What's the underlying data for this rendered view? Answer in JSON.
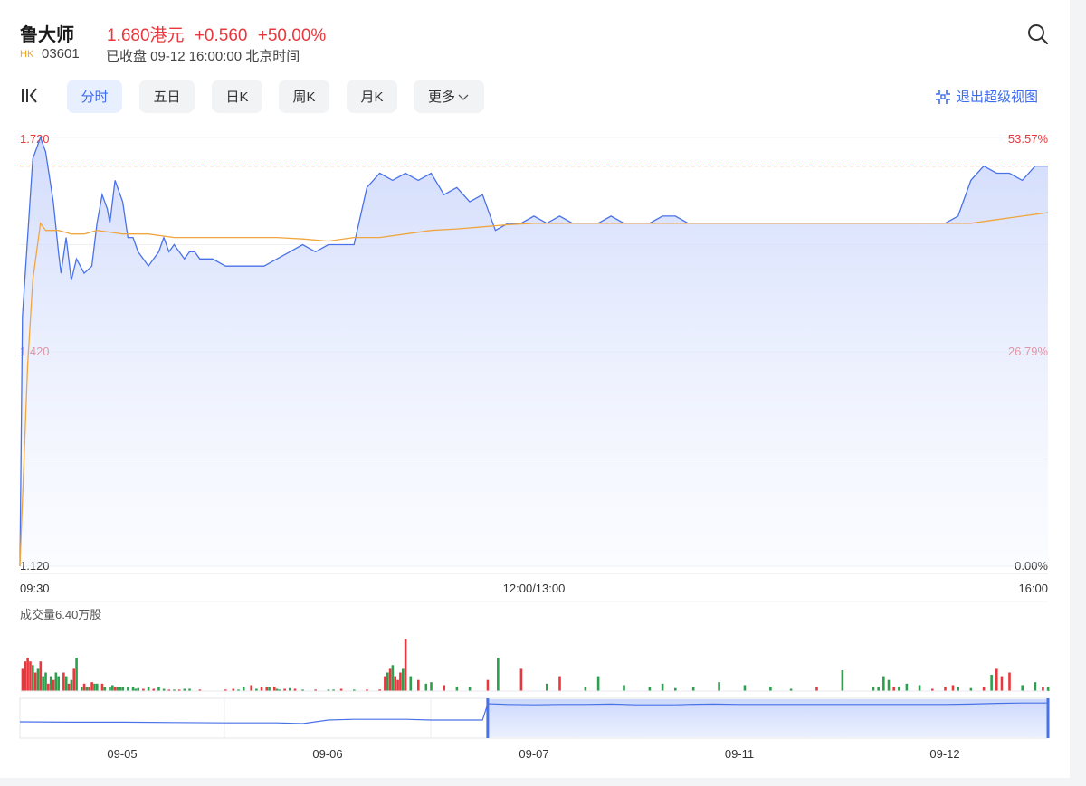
{
  "header": {
    "name": "鲁大师",
    "price": "1.680港元",
    "change": "+0.560",
    "change_pct": "+50.00%",
    "market_tag": "HK",
    "code": "03601",
    "status": "已收盘 09-12 16:00:00 北京时间"
  },
  "tabs": [
    {
      "label": "分时",
      "active": true
    },
    {
      "label": "五日",
      "active": false
    },
    {
      "label": "日K",
      "active": false
    },
    {
      "label": "周K",
      "active": false
    },
    {
      "label": "月K",
      "active": false
    },
    {
      "label": "更多",
      "active": false
    }
  ],
  "exit_label": "退出超级视图",
  "colors": {
    "up": "#e8383d",
    "down": "#2e9e4f",
    "price_line": "#4a72e8",
    "avg_line": "#f0a640",
    "accent": "#3d6cf0"
  },
  "icons": [
    "search-icon",
    "collapse-icon",
    "chevron-down-icon",
    "exit-fullscreen-icon"
  ],
  "chart_data": [
    {
      "type": "line",
      "x_labels": [
        "09:30",
        "12:00/13:00",
        "16:00"
      ],
      "y_labels_left": [
        "1.720",
        "1.420",
        "1.120"
      ],
      "y_labels_right": [
        "53.57%",
        "26.79%",
        "0.00%"
      ],
      "ylim": [
        1.12,
        1.72
      ],
      "prev_close_ref": 1.68,
      "grid": true,
      "series": [
        {
          "key": "price",
          "x": [
            0,
            1,
            3,
            5,
            8,
            10,
            13,
            15,
            16,
            18,
            20,
            22,
            25,
            28,
            30,
            32,
            34,
            35,
            37,
            40,
            42,
            44,
            46,
            48,
            50,
            52,
            54,
            56,
            58,
            60,
            62,
            64,
            66,
            68,
            70,
            75,
            80,
            85,
            90,
            95,
            100,
            105,
            110,
            115,
            120,
            125,
            130,
            135,
            140,
            145,
            150,
            155,
            160,
            165,
            170,
            175,
            180,
            185,
            190,
            195,
            200,
            205,
            210,
            215,
            220,
            225,
            230,
            235,
            240,
            245,
            250,
            255,
            260,
            265,
            270,
            275,
            280,
            285,
            290,
            295,
            300,
            305,
            310,
            315,
            320,
            325,
            330,
            335,
            340,
            345,
            350,
            355,
            360,
            365,
            370,
            375,
            380,
            385,
            390,
            395,
            400
          ],
          "values": [
            1.12,
            1.47,
            1.58,
            1.69,
            1.72,
            1.7,
            1.63,
            1.56,
            1.53,
            1.58,
            1.52,
            1.55,
            1.53,
            1.54,
            1.6,
            1.64,
            1.62,
            1.6,
            1.66,
            1.63,
            1.58,
            1.58,
            1.56,
            1.55,
            1.54,
            1.55,
            1.56,
            1.58,
            1.56,
            1.57,
            1.56,
            1.55,
            1.56,
            1.56,
            1.55,
            1.55,
            1.54,
            1.54,
            1.54,
            1.54,
            1.55,
            1.56,
            1.57,
            1.56,
            1.57,
            1.57,
            1.57,
            1.65,
            1.67,
            1.66,
            1.67,
            1.66,
            1.67,
            1.64,
            1.65,
            1.63,
            1.64,
            1.59,
            1.6,
            1.6,
            1.61,
            1.6,
            1.61,
            1.6,
            1.6,
            1.6,
            1.61,
            1.6,
            1.6,
            1.6,
            1.61,
            1.61,
            1.6,
            1.6,
            1.6,
            1.6,
            1.6,
            1.6,
            1.6,
            1.6,
            1.6,
            1.6,
            1.6,
            1.6,
            1.6,
            1.6,
            1.6,
            1.6,
            1.6,
            1.6,
            1.6,
            1.6,
            1.6,
            1.61,
            1.66,
            1.68,
            1.67,
            1.67,
            1.66,
            1.68,
            1.68
          ],
          "color": "#4a72e8"
        },
        {
          "key": "avg",
          "x": [
            0,
            3,
            5,
            8,
            10,
            15,
            20,
            25,
            30,
            40,
            50,
            60,
            70,
            80,
            90,
            100,
            110,
            120,
            130,
            140,
            150,
            160,
            170,
            180,
            190,
            200,
            210,
            220,
            230,
            240,
            250,
            260,
            270,
            280,
            290,
            300,
            310,
            320,
            330,
            340,
            350,
            360,
            370,
            380,
            390,
            400
          ],
          "values": [
            1.12,
            1.4,
            1.52,
            1.6,
            1.59,
            1.59,
            1.585,
            1.585,
            1.59,
            1.585,
            1.585,
            1.58,
            1.58,
            1.58,
            1.58,
            1.58,
            1.578,
            1.575,
            1.58,
            1.58,
            1.585,
            1.59,
            1.592,
            1.595,
            1.598,
            1.6,
            1.6,
            1.6,
            1.6,
            1.6,
            1.6,
            1.6,
            1.6,
            1.6,
            1.6,
            1.6,
            1.6,
            1.6,
            1.6,
            1.6,
            1.6,
            1.6,
            1.6,
            1.605,
            1.61,
            1.615
          ],
          "color": "#f0a640"
        }
      ]
    },
    {
      "type": "bar",
      "title": "成交量6.40万股",
      "x": [
        1,
        2,
        3,
        4,
        5,
        6,
        7,
        8,
        9,
        10,
        11,
        12,
        13,
        14,
        15,
        17,
        18,
        19,
        20,
        21,
        22,
        24,
        25,
        26,
        27,
        28,
        29,
        30,
        32,
        33,
        35,
        36,
        37,
        38,
        39,
        40,
        42,
        44,
        45,
        46,
        48,
        50,
        52,
        54,
        56,
        58,
        60,
        62,
        64,
        66,
        70,
        80,
        83,
        85,
        87,
        90,
        92,
        94,
        96,
        97,
        99,
        100,
        101,
        103,
        105,
        107,
        110,
        115,
        120,
        122,
        125,
        130,
        135,
        140,
        145,
        140,
        142,
        143,
        144,
        145,
        146,
        147,
        148,
        149,
        150,
        152,
        155,
        158,
        160,
        165,
        170,
        175,
        182,
        186,
        195,
        205,
        210,
        220,
        225,
        235,
        245,
        250,
        255,
        262,
        272,
        282,
        292,
        300,
        310,
        320,
        332,
        334,
        336,
        338,
        340,
        342,
        345,
        350,
        355,
        360,
        363,
        365,
        370,
        375,
        378,
        380,
        382,
        385,
        390,
        395,
        398,
        400
      ],
      "values": [
        0.3,
        0.4,
        0.45,
        0.4,
        0.35,
        0.25,
        0.3,
        0.4,
        0.2,
        0.25,
        0.1,
        0.2,
        0.15,
        0.25,
        0.2,
        0.25,
        0.2,
        0.1,
        0.15,
        0.3,
        0.45,
        0.05,
        0.1,
        0.05,
        0.05,
        0.12,
        0.1,
        0.1,
        0.1,
        0.05,
        0.05,
        0.08,
        0.06,
        0.05,
        0.05,
        0.05,
        0.05,
        0.05,
        0.03,
        0.04,
        0.03,
        0.05,
        0.03,
        0.05,
        0.03,
        0.02,
        0.02,
        0.02,
        0.03,
        0.03,
        0.02,
        0.02,
        0.03,
        0.02,
        0.05,
        0.08,
        0.03,
        0.05,
        0.06,
        0.05,
        0.06,
        0.03,
        0.02,
        0.03,
        0.04,
        0.03,
        0.02,
        0.02,
        0.02,
        0.02,
        0.03,
        0.02,
        0.02,
        0.02,
        0.02,
        0.02,
        0.2,
        0.25,
        0.3,
        0.35,
        0.2,
        0.15,
        0.25,
        0.3,
        0.7,
        0.2,
        0.15,
        0.1,
        0.12,
        0.08,
        0.06,
        0.05,
        0.15,
        0.45,
        0.3,
        0.1,
        0.2,
        0.05,
        0.2,
        0.08,
        0.05,
        0.1,
        0.04,
        0.05,
        0.12,
        0.08,
        0.06,
        0.03,
        0.05,
        0.28,
        0.05,
        0.06,
        0.2,
        0.15,
        0.05,
        0.06,
        0.1,
        0.08,
        0.03,
        0.06,
        0.08,
        0.05,
        0.04,
        0.05,
        0.22,
        0.3,
        0.2,
        0.25,
        0.08,
        0.12,
        0.05,
        0.06,
        0.18,
        0.25,
        0.15,
        0.1,
        0.22
      ],
      "direction": [
        "u",
        "u",
        "u",
        "u",
        "d",
        "u",
        "d",
        "u",
        "d",
        "d",
        "u",
        "d",
        "u",
        "d",
        "d",
        "u",
        "d",
        "u",
        "d",
        "u",
        "d",
        "d",
        "u",
        "d",
        "u",
        "u",
        "d",
        "d",
        "u",
        "d",
        "d",
        "d",
        "u",
        "d",
        "d",
        "d",
        "d",
        "d",
        "d",
        "d",
        "u",
        "d",
        "u",
        "d",
        "d",
        "u",
        "d",
        "u",
        "d",
        "d",
        "u",
        "u",
        "u",
        "d",
        "d",
        "u",
        "d",
        "u",
        "u",
        "d",
        "u",
        "d",
        "d",
        "u",
        "d",
        "u",
        "d",
        "u",
        "d",
        "d",
        "u",
        "d",
        "u",
        "d",
        "d",
        "u",
        "u",
        "d",
        "u",
        "d",
        "u",
        "u",
        "u",
        "d",
        "u",
        "d",
        "u",
        "d",
        "d",
        "u",
        "d",
        "d",
        "u",
        "d",
        "u",
        "d",
        "u",
        "d",
        "d",
        "d",
        "d",
        "d",
        "d",
        "d",
        "d",
        "d",
        "d",
        "d",
        "u",
        "d",
        "d",
        "d",
        "d",
        "d",
        "u",
        "d",
        "d",
        "d",
        "u",
        "u",
        "u",
        "d",
        "d",
        "u",
        "d",
        "u",
        "u",
        "u",
        "d",
        "d",
        "u",
        "d",
        "d",
        "d",
        "d",
        "d",
        "d",
        "d",
        "d",
        "d",
        "d",
        "d",
        "d"
      ]
    },
    {
      "type": "area",
      "x_labels": [
        "09-05",
        "09-06",
        "09-07",
        "09-11",
        "09-12"
      ],
      "series": [
        {
          "key": "navigator",
          "x": [
            0,
            20,
            40,
            60,
            80,
            100,
            110,
            120,
            130,
            140,
            150,
            160,
            170,
            180,
            182,
            190,
            200,
            210,
            220,
            230,
            240,
            250,
            255,
            260,
            270,
            280,
            290,
            300,
            310,
            320,
            330,
            340,
            350,
            360,
            370,
            380,
            390,
            400
          ],
          "values": [
            0.45,
            0.44,
            0.44,
            0.43,
            0.42,
            0.42,
            0.4,
            0.5,
            0.52,
            0.52,
            0.52,
            0.5,
            0.5,
            0.5,
            0.95,
            0.93,
            0.92,
            0.93,
            0.93,
            0.94,
            0.92,
            0.92,
            0.92,
            0.93,
            0.94,
            0.93,
            0.93,
            0.93,
            0.93,
            0.93,
            0.93,
            0.93,
            0.93,
            0.93,
            0.94,
            0.96,
            0.97,
            0.97
          ],
          "selection": [
            182,
            400
          ]
        }
      ]
    }
  ]
}
